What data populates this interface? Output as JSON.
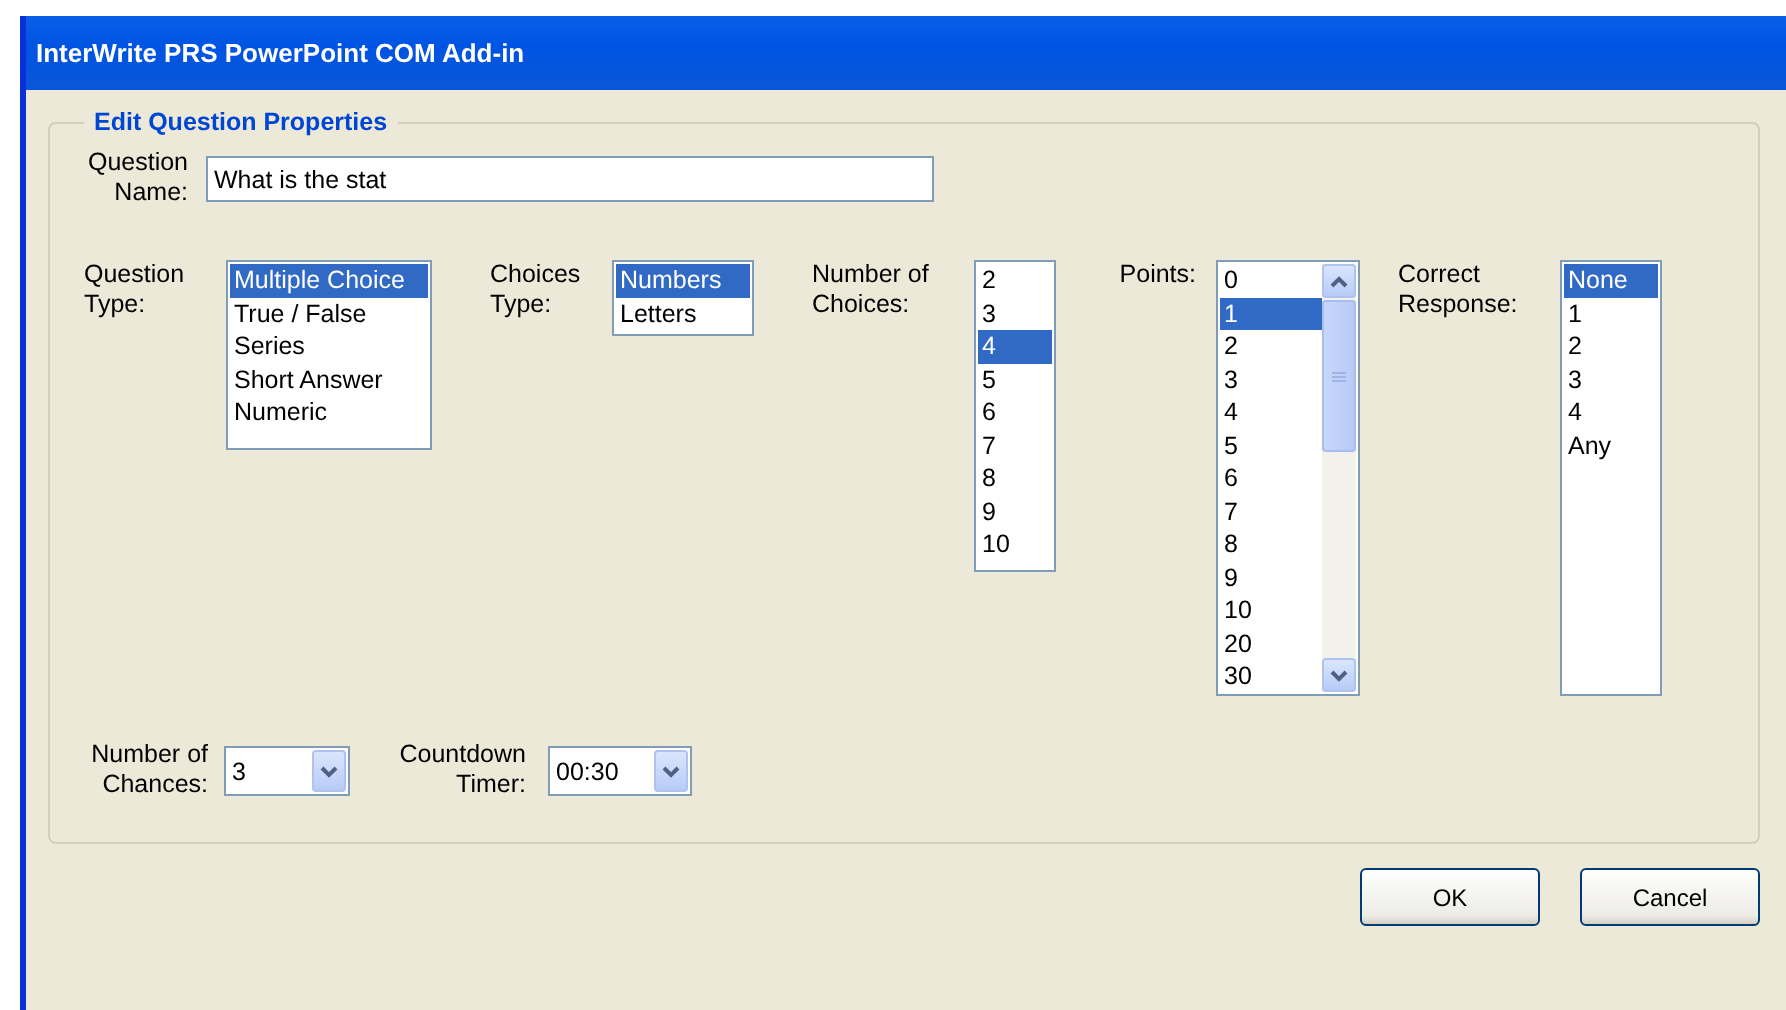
{
  "window": {
    "title": "InterWrite PRS PowerPoint COM Add-in"
  },
  "group": {
    "title": "Edit Question Properties"
  },
  "question_name": {
    "label": "Question Name:",
    "value": "What is the stat"
  },
  "lists": [
    {
      "label": "Question Type:",
      "scrollable": false,
      "items": [
        {
          "text": "Multiple Choice",
          "selected": true
        },
        {
          "text": "True / False",
          "selected": false
        },
        {
          "text": "Series",
          "selected": false
        },
        {
          "text": "Short Answer",
          "selected": false
        },
        {
          "text": "Numeric",
          "selected": false
        }
      ]
    },
    {
      "label": "Choices Type:",
      "scrollable": false,
      "items": [
        {
          "text": "Numbers",
          "selected": true
        },
        {
          "text": "Letters",
          "selected": false
        }
      ]
    },
    {
      "label": "Number of Choices:",
      "scrollable": false,
      "items": [
        {
          "text": "2",
          "selected": false
        },
        {
          "text": "3",
          "selected": false
        },
        {
          "text": "4",
          "selected": true
        },
        {
          "text": "5",
          "selected": false
        },
        {
          "text": "6",
          "selected": false
        },
        {
          "text": "7",
          "selected": false
        },
        {
          "text": "8",
          "selected": false
        },
        {
          "text": "9",
          "selected": false
        },
        {
          "text": "10",
          "selected": false
        }
      ]
    },
    {
      "label": "Points:",
      "scrollable": true,
      "items": [
        {
          "text": "0",
          "selected": false
        },
        {
          "text": "1",
          "selected": true
        },
        {
          "text": "2",
          "selected": false
        },
        {
          "text": "3",
          "selected": false
        },
        {
          "text": "4",
          "selected": false
        },
        {
          "text": "5",
          "selected": false
        },
        {
          "text": "6",
          "selected": false
        },
        {
          "text": "7",
          "selected": false
        },
        {
          "text": "8",
          "selected": false
        },
        {
          "text": "9",
          "selected": false
        },
        {
          "text": "10",
          "selected": false
        },
        {
          "text": "20",
          "selected": false
        },
        {
          "text": "30",
          "selected": false
        }
      ]
    },
    {
      "label": "Correct Response:",
      "scrollable": false,
      "items": [
        {
          "text": "None",
          "selected": true
        },
        {
          "text": "1",
          "selected": false
        },
        {
          "text": "2",
          "selected": false
        },
        {
          "text": "3",
          "selected": false
        },
        {
          "text": "4",
          "selected": false
        },
        {
          "text": "Any",
          "selected": false
        }
      ]
    }
  ],
  "combos": [
    {
      "label": "Number of Chances:",
      "value": "3"
    },
    {
      "label": "Countdown Timer:",
      "value": "00:30"
    }
  ],
  "buttons": [
    "OK",
    "Cancel"
  ]
}
